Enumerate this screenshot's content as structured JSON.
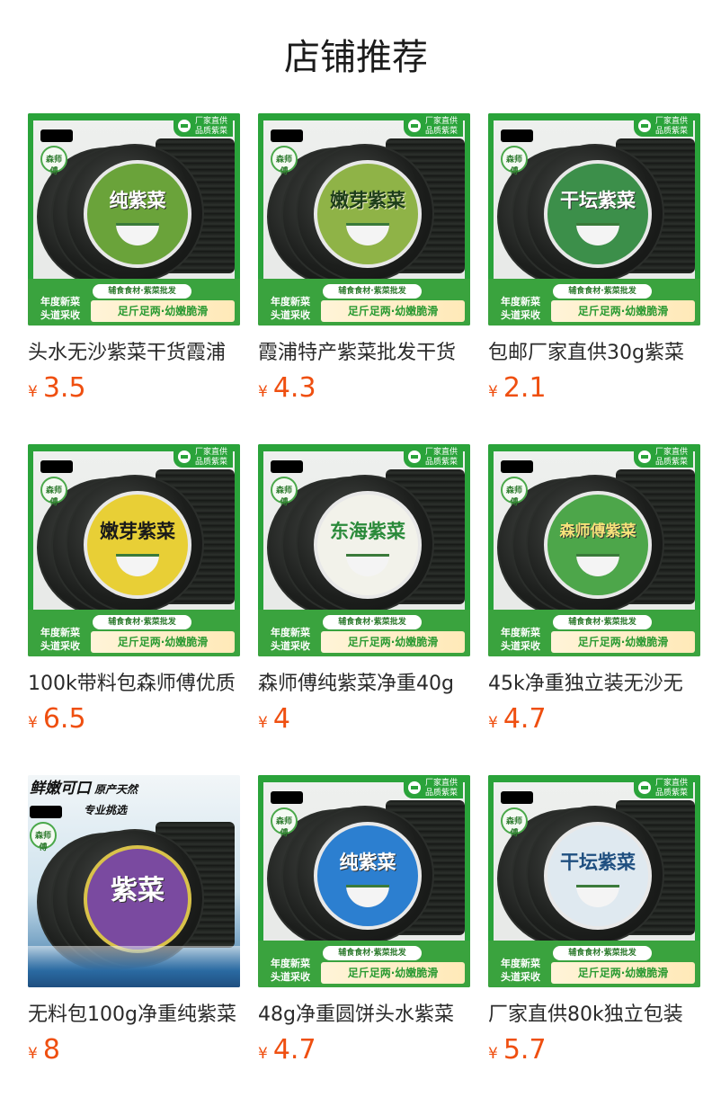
{
  "page_title": "店铺推荐",
  "common_labels": {
    "badge_line1": "厂家直供",
    "badge_line2": "品质紫菜",
    "banner_left_line1": "年度新菜",
    "banner_left_line2": "头道采收",
    "banner_tag": "辅食食材·紫菜批发",
    "banner_slogan": "足斤足两·幼嫩脆滑",
    "brand_logo": "森师傅",
    "currency_symbol": "¥"
  },
  "alt_card_labels": {
    "headline": "鲜嫩可口",
    "headline_suffix": "原产天然",
    "sub": "专业挑选"
  },
  "products": [
    {
      "name": "头水无沙紫菜干货霞浦",
      "price": "3.5",
      "package_label": "纯紫菜",
      "label_color": "#6aa33a"
    },
    {
      "name": "霞浦特产紫菜批发干货",
      "price": "4.3",
      "package_label": "嫩芽紫菜",
      "label_color": "#8fb347"
    },
    {
      "name": "包邮厂家直供30g紫菜",
      "price": "2.1",
      "package_label": "干坛紫菜",
      "label_color": "#3c8f4a"
    },
    {
      "name": "100k带料包森师傅优质",
      "price": "6.5",
      "package_label": "嫩芽紫菜",
      "label_color": "#e8cf36"
    },
    {
      "name": "森师傅纯紫菜净重40g",
      "price": "4",
      "package_label": "东海紫菜",
      "label_color": "#f2f2ea"
    },
    {
      "name": "45k净重独立装无沙无",
      "price": "4.7",
      "package_label": "森师傅紫菜",
      "label_color": "#4da64a"
    },
    {
      "name": "无料包100g净重纯紫菜",
      "price": "8",
      "package_label": "紫菜",
      "label_color": "#7a4aa0"
    },
    {
      "name": "48g净重圆饼头水紫菜",
      "price": "4.7",
      "package_label": "纯紫菜",
      "label_color": "#2c7fd0"
    },
    {
      "name": "厂家直供80k独立包装",
      "price": "5.7",
      "package_label": "干坛紫菜",
      "label_color": "#dfe9f0"
    }
  ]
}
